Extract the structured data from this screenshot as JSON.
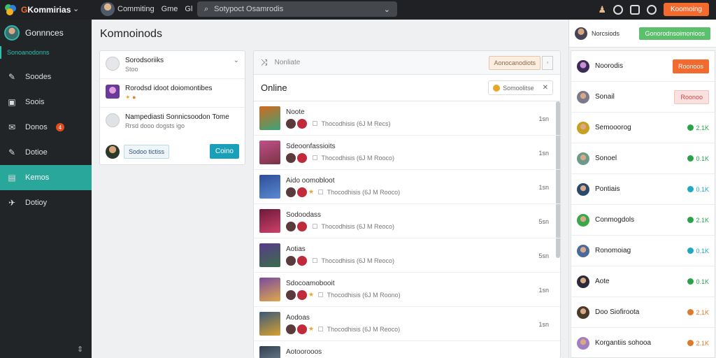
{
  "topbar": {
    "brand_prefix": "G",
    "brand_rest": "Kommirias",
    "nav": [
      "Commiting",
      "Gme",
      "Gl"
    ],
    "search_placeholder": "Sotypoct Osamrodis",
    "action_label": "Koomoing"
  },
  "sidebar": {
    "user_name": "Gonnnces",
    "sub_label": "Sonoanodonns",
    "items": [
      {
        "label": "Soodes",
        "icon": "pin-icon"
      },
      {
        "label": "Soois",
        "icon": "grid-icon"
      },
      {
        "label": "Donos",
        "icon": "mail-icon",
        "badge": "4"
      },
      {
        "label": "Dotioe",
        "icon": "pin-icon"
      },
      {
        "label": "Kemos",
        "icon": "folder-icon",
        "active": true
      },
      {
        "label": "Dotioy",
        "icon": "plane-icon"
      }
    ],
    "bottom_glyph": "⇕"
  },
  "main": {
    "title": "Komnoinods",
    "left_card": {
      "rows": [
        {
          "title": "Sorodsoriiks",
          "sub": "Stoo"
        },
        {
          "title": "Rorodsd idoot doiomontibes",
          "sub": ""
        },
        {
          "title": "Nampediasti Sonnicsoodon Tome",
          "sub": "Rrsd dooo dogsts igo"
        }
      ],
      "footer_button": "Sodoo tictiss",
      "primary_button": "Coino"
    },
    "feed": {
      "search_placeholder": "Nonliate",
      "header_button": "Aonocanodiots",
      "online_label": "Online",
      "chip_label": "Somoolitse",
      "rows": [
        {
          "name": "Noote",
          "sub": "Thocodhisis (6J M Recs)",
          "time": "1sn",
          "c1": "#d2691e",
          "c2": "#3aa57a"
        },
        {
          "name": "Sdeoonfassioits",
          "sub": "Thocodhisis (6J M Rooco)",
          "time": "1sn",
          "c1": "#c0508a",
          "c2": "#7a3344"
        },
        {
          "name": "Aido oomobloot",
          "sub": "Thocodhisis (6J M Rooco)",
          "time": "1sn",
          "c1": "#2f4d9a",
          "c2": "#5a8ad0"
        },
        {
          "name": "Sodoodass",
          "sub": "Thocodhisis (6J M Reoco)",
          "time": "5sn",
          "c1": "#6b1a3a",
          "c2": "#d0406a"
        },
        {
          "name": "Aotias",
          "sub": "Thocodhisis (6J M Reoco)",
          "time": "5sn",
          "c1": "#5a3a8a",
          "c2": "#3a6e4a"
        },
        {
          "name": "Sdocoamobooit",
          "sub": "Thocodhisis (6J M Roono)",
          "time": "1sn",
          "c1": "#7a4aa0",
          "c2": "#e0a84a"
        },
        {
          "name": "Aodoas",
          "sub": "Thocodhisis (6J M Reoco)",
          "time": "1sn",
          "c1": "#3a5a7a",
          "c2": "#d8a030"
        },
        {
          "name": "Aotoorooos",
          "sub": "",
          "time": "",
          "c1": "#304050",
          "c2": "#8090a0"
        }
      ]
    }
  },
  "right_panel": {
    "top_name": "Norcsiods",
    "top_button": "Gonorodnsoimonioos",
    "header": {
      "name": "Noorodis",
      "button": "Roonoos"
    },
    "rows": [
      {
        "name": "Sonail",
        "button": "Roonoo",
        "stat": "",
        "color": ""
      },
      {
        "name": "Semooorog",
        "stat": "2.1K",
        "color": "#29a34a"
      },
      {
        "name": "Sonoel",
        "stat": "0.1K",
        "color": "#29a34a"
      },
      {
        "name": "Pontiais",
        "stat": "0.1K",
        "color": "#1fa8c0"
      },
      {
        "name": "Conmogdols",
        "stat": "2.1K",
        "color": "#29a34a"
      },
      {
        "name": "Ronomoiag",
        "stat": "0.1K",
        "color": "#1fa8c0"
      },
      {
        "name": "Aote",
        "stat": "0.1K",
        "color": "#29a34a"
      },
      {
        "name": "Doo Siofiroota",
        "stat": "2.1K",
        "color": "#e07a2a"
      },
      {
        "name": "Korgantiis sohooa",
        "stat": "2.1K",
        "color": "#e07a2a"
      }
    ]
  }
}
